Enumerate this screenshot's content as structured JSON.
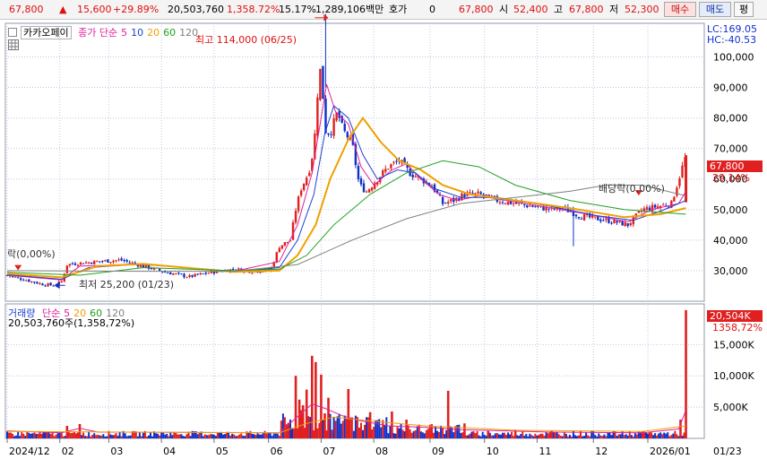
{
  "header": {
    "price": "67,800",
    "change": "15,600",
    "change_pct": "+29.89%",
    "volume": "20,503,760",
    "volume_ratio": "1,358.72%",
    "turnover": "15.17%",
    "trade_value": "1,289,106백만",
    "quote_label": "호가",
    "quote_value": "0",
    "ask_price": "67,800",
    "open_label": "시",
    "open_value": "52,400",
    "high_label": "고",
    "high_value": "67,800",
    "low_label": "저",
    "low_value": "52,300",
    "buy_button": "매수",
    "sell_button": "매도",
    "eval_button": "평"
  },
  "price_panel": {
    "stock_name": "카카오페이",
    "ma_label": "종가 단순",
    "ma_periods": [
      "5",
      "10",
      "20",
      "60",
      "120"
    ],
    "lc": "LC:169.05",
    "hc": "HC:-40.53",
    "high_annotation": "최고 114,000 (06/25)",
    "low_annotation": "최저 25,200 (01/23)",
    "div_left": "락(0,00%)",
    "div_right": "배당락(0,00%)",
    "last_price": "67,800",
    "last_pct": "29.14%"
  },
  "volume_panel": {
    "title": "거래량",
    "ma_label": "단순",
    "ma_periods": [
      "5",
      "20",
      "60",
      "120"
    ],
    "summary": "20,503,760주(1,358,72%)",
    "last_volume": "20,504K",
    "last_pct": "1358,72%"
  },
  "colors": {
    "up": "#e02020",
    "down": "#1030c8",
    "ma5": "#e0209a",
    "ma10": "#2040d0",
    "ma20": "#f0a000",
    "ma60": "#20a020",
    "ma120": "#808080",
    "grid": "#c0c8e0"
  },
  "chart_data": {
    "type": "candlestick",
    "price_axis": {
      "ticks": [
        30000,
        40000,
        50000,
        60000,
        70000,
        80000,
        90000,
        100000
      ],
      "labels": [
        "30,000",
        "40,000",
        "50,000",
        "60,000",
        "70,000",
        "80,000",
        "90,000",
        "100,000"
      ],
      "ylim": [
        20000,
        111000
      ]
    },
    "volume_axis": {
      "ticks": [
        5000,
        10000,
        15000
      ],
      "labels": [
        "5,000K",
        "10,000K",
        "15,000K"
      ],
      "ylim": [
        0,
        21500
      ]
    },
    "x_labels": [
      "2024/12",
      "02",
      "03",
      "04",
      "05",
      "06",
      "07",
      "08",
      "09",
      "10",
      "11",
      "12",
      "2026/01",
      "01/23"
    ],
    "x_label_days": [
      0,
      58,
      112,
      170,
      228,
      288,
      346,
      404,
      466,
      526,
      584,
      646,
      706,
      784
    ],
    "last_day": 748,
    "close_series": [
      [
        0,
        28500
      ],
      [
        20,
        27000
      ],
      [
        40,
        25500
      ],
      [
        52,
        25200
      ],
      [
        60,
        26500
      ],
      [
        66,
        32000
      ],
      [
        80,
        32500
      ],
      [
        100,
        33000
      ],
      [
        125,
        33500
      ],
      [
        150,
        31500
      ],
      [
        175,
        29500
      ],
      [
        200,
        28000
      ],
      [
        225,
        29500
      ],
      [
        250,
        30500
      ],
      [
        270,
        29800
      ],
      [
        290,
        30200
      ],
      [
        300,
        38000
      ],
      [
        312,
        40000
      ],
      [
        318,
        50000
      ],
      [
        324,
        57000
      ],
      [
        332,
        62000
      ],
      [
        338,
        70000
      ],
      [
        342,
        88000
      ],
      [
        346,
        98000
      ],
      [
        350,
        76000
      ],
      [
        356,
        75000
      ],
      [
        364,
        82000
      ],
      [
        370,
        76000
      ],
      [
        380,
        72000
      ],
      [
        388,
        58000
      ],
      [
        396,
        56000
      ],
      [
        408,
        60000
      ],
      [
        420,
        64000
      ],
      [
        432,
        66000
      ],
      [
        444,
        62000
      ],
      [
        456,
        60000
      ],
      [
        468,
        58000
      ],
      [
        480,
        52000
      ],
      [
        492,
        53000
      ],
      [
        504,
        55000
      ],
      [
        520,
        55000
      ],
      [
        540,
        53000
      ],
      [
        560,
        52000
      ],
      [
        580,
        51000
      ],
      [
        600,
        50000
      ],
      [
        612,
        50500
      ],
      [
        630,
        48000
      ],
      [
        650,
        47000
      ],
      [
        670,
        46000
      ],
      [
        684,
        45000
      ],
      [
        700,
        50000
      ],
      [
        716,
        51000
      ],
      [
        732,
        52000
      ],
      [
        748,
        67800
      ]
    ],
    "ma_series": [
      {
        "name": "5",
        "points": [
          [
            0,
            28500
          ],
          [
            60,
            27000
          ],
          [
            80,
            31500
          ],
          [
            150,
            32000
          ],
          [
            250,
            29800
          ],
          [
            300,
            33000
          ],
          [
            320,
            45000
          ],
          [
            336,
            62000
          ],
          [
            346,
            80000
          ],
          [
            352,
            91000
          ],
          [
            362,
            82000
          ],
          [
            376,
            78000
          ],
          [
            390,
            64000
          ],
          [
            404,
            58000
          ],
          [
            424,
            63000
          ],
          [
            440,
            65000
          ],
          [
            456,
            60000
          ],
          [
            476,
            55000
          ],
          [
            496,
            53000
          ],
          [
            520,
            54500
          ],
          [
            560,
            52500
          ],
          [
            600,
            50500
          ],
          [
            640,
            48500
          ],
          [
            684,
            46000
          ],
          [
            710,
            50000
          ],
          [
            740,
            52000
          ],
          [
            748,
            56000
          ]
        ]
      },
      {
        "name": "10",
        "points": [
          [
            0,
            28700
          ],
          [
            60,
            27200
          ],
          [
            90,
            31000
          ],
          [
            150,
            32200
          ],
          [
            250,
            29700
          ],
          [
            300,
            31000
          ],
          [
            320,
            40000
          ],
          [
            338,
            55000
          ],
          [
            350,
            75000
          ],
          [
            360,
            84000
          ],
          [
            376,
            80000
          ],
          [
            392,
            68000
          ],
          [
            408,
            60000
          ],
          [
            430,
            63000
          ],
          [
            450,
            62000
          ],
          [
            470,
            57000
          ],
          [
            500,
            54000
          ],
          [
            540,
            54000
          ],
          [
            600,
            51000
          ],
          [
            650,
            48000
          ],
          [
            690,
            46500
          ],
          [
            720,
            49500
          ],
          [
            748,
            53000
          ]
        ]
      },
      {
        "name": "20",
        "points": [
          [
            0,
            29000
          ],
          [
            60,
            27800
          ],
          [
            100,
            31500
          ],
          [
            150,
            32200
          ],
          [
            250,
            29600
          ],
          [
            300,
            30000
          ],
          [
            320,
            35000
          ],
          [
            340,
            45000
          ],
          [
            356,
            60000
          ],
          [
            376,
            73000
          ],
          [
            392,
            80000
          ],
          [
            412,
            72000
          ],
          [
            432,
            66000
          ],
          [
            456,
            63000
          ],
          [
            480,
            58000
          ],
          [
            510,
            55000
          ],
          [
            560,
            53000
          ],
          [
            620,
            50500
          ],
          [
            680,
            47500
          ],
          [
            720,
            48500
          ],
          [
            748,
            50500
          ]
        ]
      },
      {
        "name": "60",
        "points": [
          [
            0,
            29500
          ],
          [
            80,
            28500
          ],
          [
            150,
            31000
          ],
          [
            250,
            30000
          ],
          [
            300,
            30500
          ],
          [
            330,
            35000
          ],
          [
            360,
            45000
          ],
          [
            400,
            55000
          ],
          [
            440,
            62000
          ],
          [
            480,
            66000
          ],
          [
            520,
            64000
          ],
          [
            560,
            58000
          ],
          [
            620,
            53000
          ],
          [
            680,
            50000
          ],
          [
            748,
            48500
          ]
        ]
      },
      {
        "name": "120",
        "points": [
          [
            0,
            30000
          ],
          [
            150,
            29800
          ],
          [
            250,
            29800
          ],
          [
            320,
            32000
          ],
          [
            380,
            40000
          ],
          [
            440,
            47000
          ],
          [
            500,
            52000
          ],
          [
            560,
            54000
          ],
          [
            620,
            56000
          ],
          [
            660,
            58000
          ],
          [
            700,
            58000
          ],
          [
            748,
            54500
          ]
        ]
      }
    ],
    "volume_spikes": [
      [
        66,
        2000
      ],
      [
        80,
        2300
      ],
      [
        310,
        2500
      ],
      [
        318,
        10000
      ],
      [
        322,
        6200
      ],
      [
        324,
        4500
      ],
      [
        326,
        5300
      ],
      [
        330,
        7800
      ],
      [
        336,
        13200
      ],
      [
        340,
        12200
      ],
      [
        346,
        10200
      ],
      [
        350,
        4000
      ],
      [
        354,
        6500
      ],
      [
        376,
        7900
      ],
      [
        400,
        4200
      ],
      [
        424,
        4300
      ],
      [
        440,
        3000
      ],
      [
        486,
        7600
      ],
      [
        504,
        2400
      ],
      [
        530,
        1200
      ],
      [
        560,
        1400
      ],
      [
        600,
        1200
      ],
      [
        700,
        1100
      ],
      [
        742,
        3000
      ],
      [
        748,
        20504
      ]
    ],
    "volume_ma5": [
      [
        0,
        1200
      ],
      [
        60,
        900
      ],
      [
        80,
        1600
      ],
      [
        100,
        1000
      ],
      [
        300,
        900
      ],
      [
        320,
        3500
      ],
      [
        336,
        5500
      ],
      [
        350,
        4800
      ],
      [
        370,
        3600
      ],
      [
        390,
        2800
      ],
      [
        420,
        2000
      ],
      [
        470,
        1700
      ],
      [
        500,
        1400
      ],
      [
        600,
        1000
      ],
      [
        700,
        900
      ],
      [
        740,
        1500
      ],
      [
        748,
        4500
      ]
    ],
    "volume_ma20": [
      [
        0,
        1100
      ],
      [
        300,
        900
      ],
      [
        330,
        2400
      ],
      [
        360,
        3400
      ],
      [
        400,
        2800
      ],
      [
        460,
        2000
      ],
      [
        560,
        1300
      ],
      [
        700,
        1100
      ],
      [
        748,
        2000
      ]
    ]
  }
}
